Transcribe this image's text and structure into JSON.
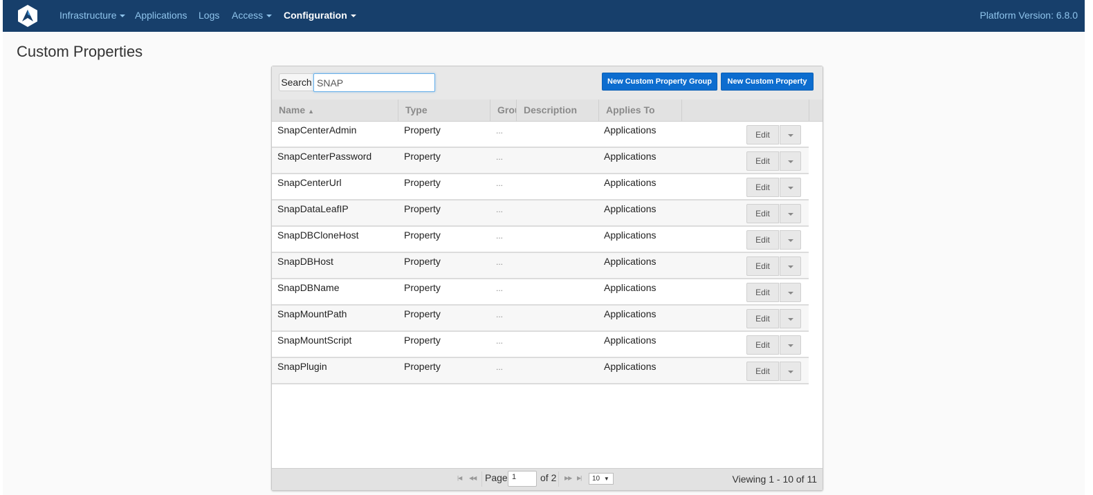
{
  "nav": {
    "items": [
      {
        "label": "Infrastructure",
        "dropdown": true,
        "active": false
      },
      {
        "label": "Applications",
        "dropdown": false,
        "active": false
      },
      {
        "label": "Logs",
        "dropdown": false,
        "active": false
      },
      {
        "label": "Access",
        "dropdown": true,
        "active": false
      },
      {
        "label": "Configuration",
        "dropdown": true,
        "active": true
      }
    ],
    "version": "Platform Version: 6.8.0"
  },
  "page": {
    "title": "Custom Properties"
  },
  "toolbar": {
    "search_label": "Search",
    "search_value": "SNAP",
    "new_group_label": "New Custom Property Group",
    "new_property_label": "New Custom Property"
  },
  "table": {
    "columns": [
      "Name",
      "Type",
      "Group",
      "Description",
      "Applies To"
    ],
    "sort_column": "Name",
    "rows": [
      {
        "name": "SnapCenterAdmin",
        "type": "Property",
        "group": "...",
        "applies_to": "Applications"
      },
      {
        "name": "SnapCenterPassword",
        "type": "Property",
        "group": "...",
        "applies_to": "Applications"
      },
      {
        "name": "SnapCenterUrl",
        "type": "Property",
        "group": "...",
        "applies_to": "Applications"
      },
      {
        "name": "SnapDataLeafIP",
        "type": "Property",
        "group": "...",
        "applies_to": "Applications"
      },
      {
        "name": "SnapDBCloneHost",
        "type": "Property",
        "group": "...",
        "applies_to": "Applications"
      },
      {
        "name": "SnapDBHost",
        "type": "Property",
        "group": "...",
        "applies_to": "Applications"
      },
      {
        "name": "SnapDBName",
        "type": "Property",
        "group": "...",
        "applies_to": "Applications"
      },
      {
        "name": "SnapMountPath",
        "type": "Property",
        "group": "...",
        "applies_to": "Applications"
      },
      {
        "name": "SnapMountScript",
        "type": "Property",
        "group": "...",
        "applies_to": "Applications"
      },
      {
        "name": "SnapPlugin",
        "type": "Property",
        "group": "...",
        "applies_to": "Applications"
      }
    ],
    "edit_label": "Edit"
  },
  "pager": {
    "page_label": "Page",
    "current_page": "1",
    "of_label": "of 2",
    "rows_per_page": "10",
    "viewing": "Viewing 1 - 10 of 11"
  },
  "icons": {
    "logo": "app-logo-icon",
    "sort": "sort-icon",
    "first": "first-page-icon",
    "prev": "prev-page-icon",
    "next": "next-page-icon",
    "last": "last-page-icon"
  },
  "colors": {
    "navbar": "#173f6b",
    "nav_link": "#8fc4ec",
    "primary_button": "#0d6dcf"
  }
}
